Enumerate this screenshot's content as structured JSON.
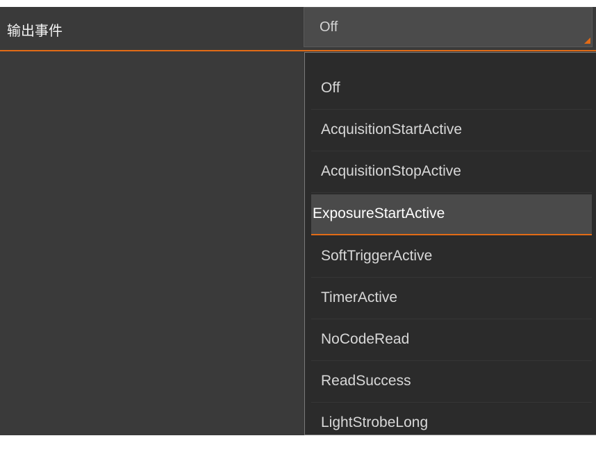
{
  "property": {
    "label": "输出事件",
    "current_value": "Off"
  },
  "dropdown": {
    "selected_index": 3,
    "options": [
      "Off",
      "AcquisitionStartActive",
      "AcquisitionStopActive",
      "ExposureStartActive",
      "SoftTriggerActive",
      "TimerActive",
      "NoCodeRead",
      "ReadSuccess",
      "LightStrobeLong"
    ]
  },
  "colors": {
    "accent": "#e26b16",
    "panel_bg": "#3a3a3a",
    "dropdown_bg": "#2b2b2b",
    "highlight_bg": "#4a4a4a"
  },
  "icons": {
    "select_caret": "caret-corner-icon"
  }
}
